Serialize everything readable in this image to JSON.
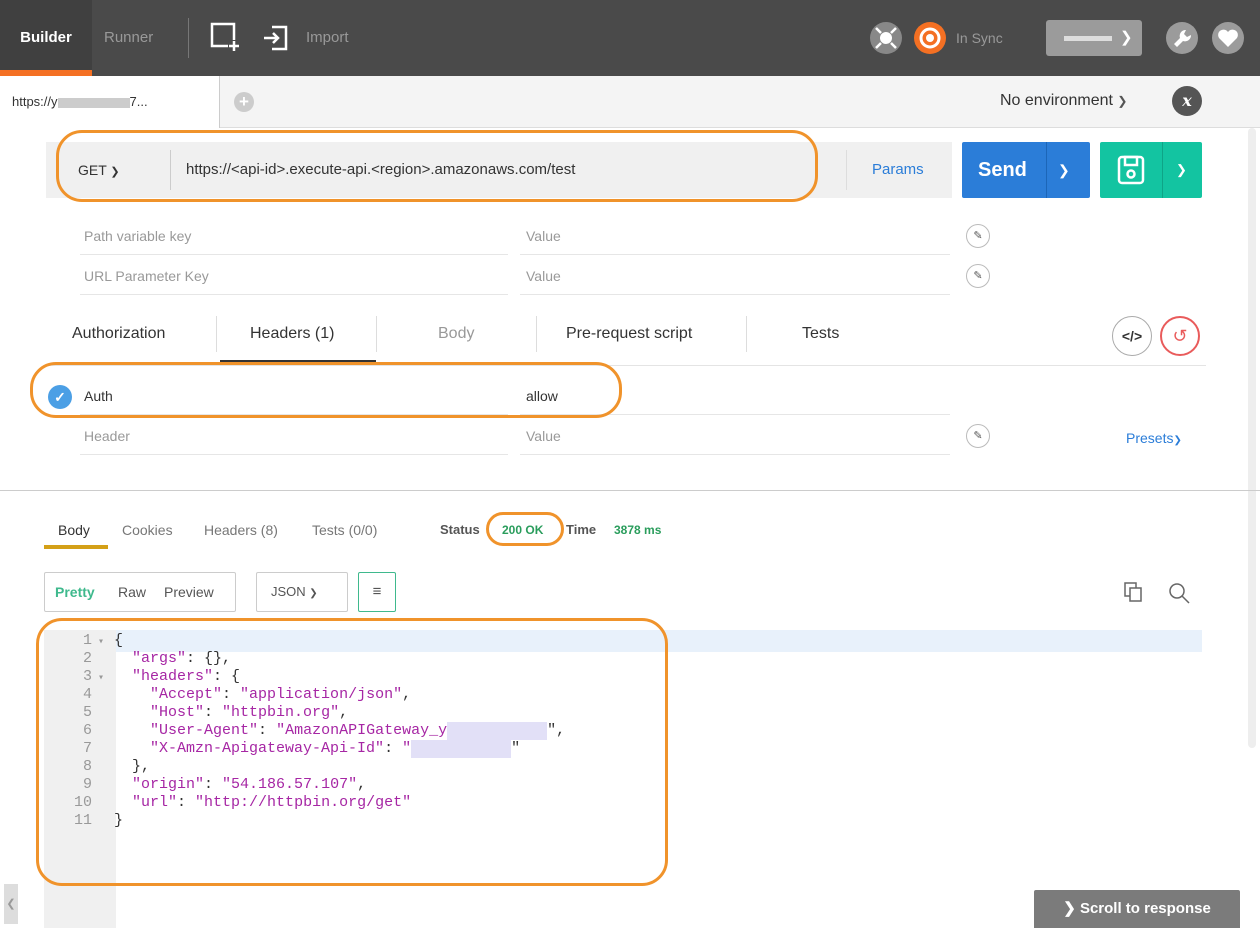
{
  "topbar": {
    "builder": "Builder",
    "runner": "Runner",
    "import": "Import",
    "sync": "In Sync"
  },
  "tabs": {
    "request_tab": "https://y",
    "request_tab_suffix": "7...",
    "environment": "No environment",
    "env_icon_label": "x"
  },
  "request": {
    "method": "GET",
    "url": "https://<api-id>.execute-api.<region>.amazonaws.com/test",
    "params": "Params",
    "send": "Send",
    "path_key_placeholder": "Path variable key",
    "path_value_placeholder": "Value",
    "url_key_placeholder": "URL Parameter Key",
    "url_value_placeholder": "Value"
  },
  "request_tabs": [
    "Authorization",
    "Headers (1)",
    "Body",
    "Pre-request script",
    "Tests"
  ],
  "headers": {
    "rows": [
      {
        "key": "Auth",
        "value": "allow"
      }
    ],
    "key_placeholder": "Header",
    "value_placeholder": "Value",
    "presets": "Presets"
  },
  "response": {
    "tabs": [
      "Body",
      "Cookies",
      "Headers (8)",
      "Tests (0/0)"
    ],
    "status_label": "Status",
    "status_value": "200 OK",
    "time_label": "Time",
    "time_value": "3878 ms",
    "formats": [
      "Pretty",
      "Raw",
      "Preview"
    ],
    "language": "JSON",
    "scroll_to_response": "Scroll to response"
  },
  "code_lines": [
    {
      "n": "1",
      "fold": true,
      "text": "{"
    },
    {
      "n": "2",
      "fold": false,
      "text": "  \"args\": {},"
    },
    {
      "n": "3",
      "fold": true,
      "text": "  \"headers\": {"
    },
    {
      "n": "4",
      "fold": false,
      "text": "    \"Accept\": \"application/json\","
    },
    {
      "n": "5",
      "fold": false,
      "text": "    \"Host\": \"httpbin.org\","
    },
    {
      "n": "6",
      "fold": false,
      "text": "    \"User-Agent\": \"AmazonAPIGateway_y"
    },
    {
      "n": "7",
      "fold": false,
      "text": "    \"X-Amzn-Apigateway-Api-Id\": \""
    },
    {
      "n": "8",
      "fold": false,
      "text": "  },"
    },
    {
      "n": "9",
      "fold": false,
      "text": "  \"origin\": \"54.186.57.107\","
    },
    {
      "n": "10",
      "fold": false,
      "text": "  \"url\": \"http://httpbin.org/get\""
    },
    {
      "n": "11",
      "fold": false,
      "text": "}"
    }
  ],
  "code_tails": {
    "6": "\",",
    "7": "\""
  }
}
